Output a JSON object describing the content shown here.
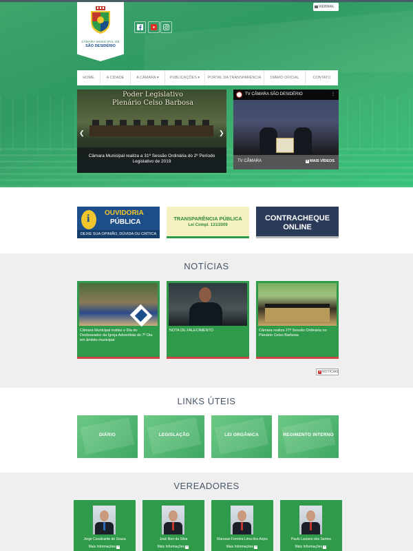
{
  "header": {
    "logo": {
      "line1": "CÂMARA MUNICIPAL DE",
      "line2": "SÃO DESIDÉRIO"
    },
    "webmail": "WEBMAIL",
    "social": [
      "facebook-icon",
      "youtube-icon",
      "instagram-icon"
    ]
  },
  "nav": {
    "items": [
      "HOME",
      "A CIDADE",
      "A CÂMARA ▾",
      "PUBLICAÇÕES ▾",
      "PORTAL DA TRANSPARÊNCIA",
      "DIÁRIO OFICIAL",
      "CONTATO"
    ]
  },
  "slider": {
    "image_title": "Poder Legislativo\nPlenário Celso Barbosa",
    "caption": "Câmara Municipal realiza a 31ª Sessão Ordinária do 2º Período Legislativo de 2019"
  },
  "tv": {
    "title": "TV CÂMARA SÃO DESIDÉRIO",
    "label": "TV CÂMARA",
    "more": "MAIS VÍDEOS"
  },
  "banners": {
    "ouvidoria": {
      "line1": "OUVIDORIA",
      "line2": "PÚBLICA",
      "sub": "DEIXE SUA OPINIÃO, DÚVIDA OU CRÍTICA"
    },
    "transparencia": {
      "line1": "TRANSPARÊNCIA PÚBLICA",
      "line2": "Lei Compl. 131/2009"
    },
    "contracheque": {
      "line1": "CONTRACHEQUE",
      "line2": "ONLINE"
    }
  },
  "news": {
    "title": "NOTÍCIAS",
    "items": [
      {
        "text": "Câmara Municipal institui o Dia do Desbravador da Igreja Adventista do 7º Dia em âmbito municipal"
      },
      {
        "text": "NOTA DE FALECIMENTO"
      },
      {
        "text": "Câmara realiza 27ª Sessão Ordinária no Plenário Celso Barbosa"
      }
    ],
    "more": "NOTÍCIAS"
  },
  "links": {
    "title": "LINKS ÚTEIS",
    "items": [
      "DIÁRIO",
      "LEGISLAÇÃO",
      "LEI ORGÂNICA",
      "REGIMENTO INTERNO"
    ]
  },
  "vereadores": {
    "title": "VEREADORES",
    "items": [
      {
        "name": "Jorge Cavalcante de Souza",
        "more": "Mais Informações",
        "tie": "#2f6ab8"
      },
      {
        "name": "José Ilton da Silva",
        "more": "Mais Informações",
        "tie": "#c0392b"
      },
      {
        "name": "Marusan Ferreira Lima dos Anjos",
        "more": "Mais Informações",
        "tie": "#c0392b"
      },
      {
        "name": "Paulo Luciano dos Santos",
        "more": "Mais Informações",
        "tie": "#c0392b"
      }
    ]
  },
  "colors": {
    "primary_green": "#2f9a49",
    "accent_red": "#cc3333",
    "nav_bg": "#ffffff"
  }
}
